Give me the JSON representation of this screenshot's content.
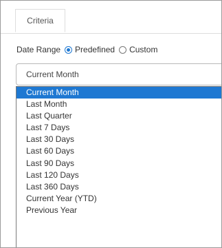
{
  "tabs": [
    {
      "label": "Criteria"
    }
  ],
  "date_range": {
    "label": "Date Range",
    "options": [
      {
        "label": "Predefined",
        "checked": true
      },
      {
        "label": "Custom",
        "checked": false
      }
    ]
  },
  "select": {
    "value": "Current Month",
    "options": [
      "Current Month",
      "Last Month",
      "Last Quarter",
      "Last 7 Days",
      "Last 30 Days",
      "Last 60 Days",
      "Last 90 Days",
      "Last 120 Days",
      "Last 360 Days",
      "Current Year (YTD)",
      "Previous Year"
    ],
    "highlighted": "Current Month"
  },
  "colors": {
    "accent": "#1e78d2",
    "border": "#b8b8b8"
  }
}
